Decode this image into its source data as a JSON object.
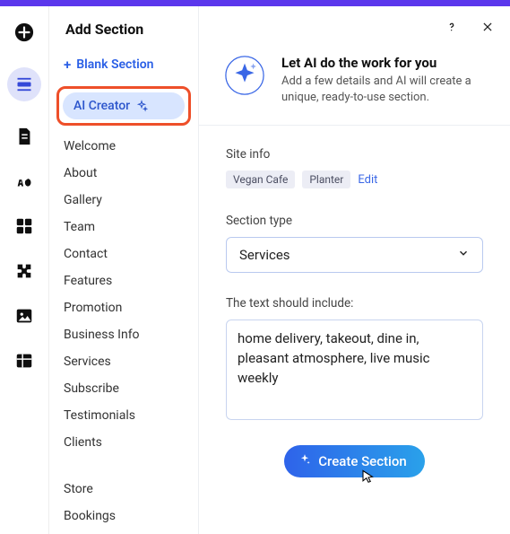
{
  "panel": {
    "title": "Add Section",
    "blank_label": "Blank Section",
    "ai_label": "AI Creator",
    "nav1": [
      "Welcome",
      "About",
      "Gallery",
      "Team",
      "Contact",
      "Features",
      "Promotion",
      "Business Info",
      "Services",
      "Subscribe",
      "Testimonials",
      "Clients"
    ],
    "nav2": [
      "Store",
      "Bookings"
    ]
  },
  "hero": {
    "title": "Let AI do the work for you",
    "subtitle": "Add a few details and AI will create a unique, ready-to-use section."
  },
  "form": {
    "site_info_label": "Site info",
    "chips": [
      "Vegan Cafe",
      "Planter"
    ],
    "edit_label": "Edit",
    "section_type_label": "Section type",
    "section_type_value": "Services",
    "text_label": "The text should include:",
    "text_value": "home delivery, takeout, dine in, pleasant atmosphere, live music weekly",
    "cta_label": "Create Section"
  }
}
